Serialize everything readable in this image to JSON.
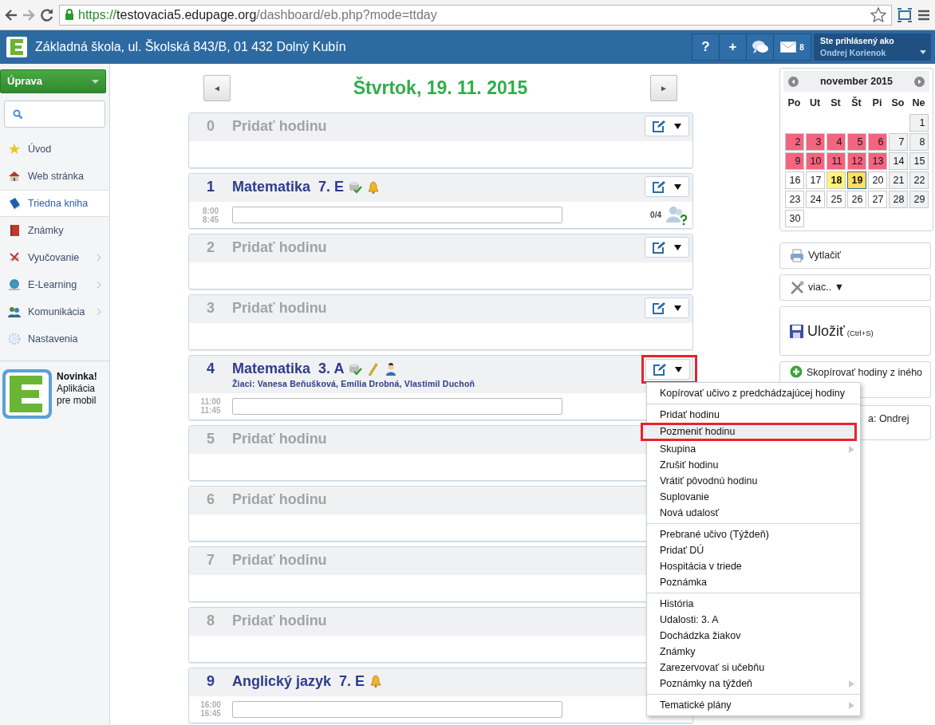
{
  "browser": {
    "url": {
      "scheme": "https://",
      "host": "testovacia5.edupage.org",
      "path": "/dashboard/eb.php?mode=ttday"
    }
  },
  "header": {
    "school": "Základná škola, ul. Školská 843/B, 01 432 Dolný Kubín",
    "buttons": [
      {
        "kind": "text",
        "label": "?"
      },
      {
        "kind": "text",
        "label": "+"
      },
      {
        "kind": "chat"
      },
      {
        "kind": "mail",
        "count": "8"
      }
    ],
    "user": {
      "caption": "Ste prihlásený ako",
      "name": "Ondrej Korienok"
    }
  },
  "sidebar": {
    "edit_button": "Úprava",
    "items": [
      {
        "label": "Úvod",
        "selected": false,
        "has_submenu": false
      },
      {
        "label": "Web stránka",
        "selected": false,
        "has_submenu": false
      },
      {
        "label": "Triedna kniha",
        "selected": true,
        "has_submenu": false
      },
      {
        "label": "Známky",
        "selected": false,
        "has_submenu": false
      },
      {
        "label": "Vyučovanie",
        "selected": false,
        "has_submenu": true
      },
      {
        "label": "E-Learning",
        "selected": false,
        "has_submenu": true
      },
      {
        "label": "Komunikácia",
        "selected": false,
        "has_submenu": true
      },
      {
        "label": "Nastavenia",
        "selected": false,
        "has_submenu": false
      }
    ],
    "promo": "**Novinka!** Aplikácia pre mobil"
  },
  "day": {
    "prev": "◄",
    "title": "Štvrtok, 19. 11. 2015",
    "next": "►"
  },
  "lessons": [
    {
      "number": "0",
      "kind": "empty",
      "title": "Pridať hodinu"
    },
    {
      "number": "1",
      "kind": "lesson",
      "subject": "Matematika",
      "class": "7. E",
      "badges": [
        {
          "kind": "check"
        },
        {
          "kind": "bell"
        }
      ],
      "start": "8:00",
      "end": "8:45",
      "attendance": "0/4"
    },
    {
      "number": "2",
      "kind": "empty",
      "title": "Pridať hodinu"
    },
    {
      "number": "3",
      "kind": "empty",
      "title": "Pridať hodinu"
    },
    {
      "number": "4",
      "kind": "lesson",
      "subject": "Matematika",
      "class": "3. A",
      "badges": [
        {
          "kind": "check"
        },
        {
          "kind": "pencil"
        },
        {
          "kind": "person"
        }
      ],
      "students": "Žiaci: Vanesa Beňušková, Emília Drobná, Vlastimil Duchoň",
      "start": "11:00",
      "end": "11:45",
      "highlighted": true,
      "menu_open": true
    },
    {
      "number": "5",
      "kind": "empty",
      "title": "Pridať hodinu"
    },
    {
      "number": "6",
      "kind": "empty",
      "title": "Pridať hodinu"
    },
    {
      "number": "7",
      "kind": "empty",
      "title": "Pridať hodinu"
    },
    {
      "number": "8",
      "kind": "empty",
      "title": "Pridať hodinu"
    },
    {
      "number": "9",
      "kind": "lesson",
      "subject": "Anglický jazyk",
      "class": "7. E",
      "badges": [
        {
          "kind": "bell"
        }
      ],
      "start": "16:00",
      "end": "16:45"
    }
  ],
  "menu": {
    "groups": [
      [
        {
          "label": "Kopírovať učivo z predchádzajúcej hodiny",
          "has_submenu": false,
          "highlighted": false
        }
      ],
      [
        {
          "label": "Pridať hodinu",
          "has_submenu": false,
          "highlighted": false
        },
        {
          "label": "Pozmeniť hodinu",
          "has_submenu": false,
          "highlighted": true
        },
        {
          "label": "Skupina",
          "has_submenu": true,
          "highlighted": false
        },
        {
          "label": "Zrušiť hodinu",
          "has_submenu": false,
          "highlighted": false
        },
        {
          "label": "Vrátiť pôvodnú hodinu",
          "has_submenu": false,
          "highlighted": false
        },
        {
          "label": "Suplovanie",
          "has_submenu": false,
          "highlighted": false
        },
        {
          "label": "Nová udalosť",
          "has_submenu": false,
          "highlighted": false
        }
      ],
      [
        {
          "label": "Prebrané učivo (Týždeň)",
          "has_submenu": false,
          "highlighted": false
        },
        {
          "label": "Pridať DÚ",
          "has_submenu": false,
          "highlighted": false
        },
        {
          "label": "Hospitácia v triede",
          "has_submenu": false,
          "highlighted": false
        },
        {
          "label": "Poznámka",
          "has_submenu": false,
          "highlighted": false
        }
      ],
      [
        {
          "label": "História",
          "has_submenu": false,
          "highlighted": false
        },
        {
          "label": "Udalosti: 3. A",
          "has_submenu": false,
          "highlighted": false
        },
        {
          "label": "Dochádzka žiakov",
          "has_submenu": false,
          "highlighted": false
        },
        {
          "label": "Známky",
          "has_submenu": false,
          "highlighted": false
        },
        {
          "label": "Zarezervovať si učebňu",
          "has_submenu": false,
          "highlighted": false
        },
        {
          "label": "Poznámky na týždeň",
          "has_submenu": true,
          "highlighted": false
        }
      ],
      [
        {
          "label": "Tematické plány",
          "has_submenu": true,
          "highlighted": false
        }
      ]
    ]
  },
  "calendar": {
    "month": "november 2015",
    "weekdays": [
      "Po",
      "Ut",
      "St",
      "Št",
      "Pi",
      "So",
      "Ne"
    ],
    "days": [
      {
        "kind": "blank"
      },
      {
        "kind": "blank"
      },
      {
        "kind": "blank"
      },
      {
        "kind": "blank"
      },
      {
        "kind": "blank"
      },
      {
        "kind": "blank"
      },
      {
        "day": "1",
        "kind": "weekend",
        "selected": false
      },
      {
        "day": "2",
        "kind": "marked",
        "selected": false
      },
      {
        "day": "3",
        "kind": "marked",
        "selected": false
      },
      {
        "day": "4",
        "kind": "marked",
        "selected": false
      },
      {
        "day": "5",
        "kind": "marked",
        "selected": false
      },
      {
        "day": "6",
        "kind": "marked",
        "selected": false
      },
      {
        "day": "7",
        "kind": "weekend",
        "selected": false
      },
      {
        "day": "8",
        "kind": "weekend",
        "selected": false
      },
      {
        "day": "9",
        "kind": "marked",
        "selected": false
      },
      {
        "day": "10",
        "kind": "marked",
        "selected": false
      },
      {
        "day": "11",
        "kind": "marked",
        "selected": false
      },
      {
        "day": "12",
        "kind": "marked",
        "selected": false
      },
      {
        "day": "13",
        "kind": "marked",
        "selected": false
      },
      {
        "day": "14",
        "kind": "weekend",
        "selected": false
      },
      {
        "day": "15",
        "kind": "weekend",
        "selected": false
      },
      {
        "day": "16",
        "kind": "plain",
        "selected": false
      },
      {
        "day": "17",
        "kind": "plain",
        "selected": false
      },
      {
        "day": "18",
        "kind": "event",
        "selected": false
      },
      {
        "day": "19",
        "kind": "event",
        "selected": true
      },
      {
        "day": "20",
        "kind": "plain",
        "selected": false
      },
      {
        "day": "21",
        "kind": "weekend",
        "selected": false
      },
      {
        "day": "22",
        "kind": "weekend",
        "selected": false
      },
      {
        "day": "23",
        "kind": "plain",
        "selected": false
      },
      {
        "day": "24",
        "kind": "plain",
        "selected": false
      },
      {
        "day": "25",
        "kind": "plain",
        "selected": false
      },
      {
        "day": "26",
        "kind": "plain",
        "selected": false
      },
      {
        "day": "27",
        "kind": "plain",
        "selected": false
      },
      {
        "day": "28",
        "kind": "weekend",
        "selected": false
      },
      {
        "day": "29",
        "kind": "weekend",
        "selected": false
      },
      {
        "day": "30",
        "kind": "plain",
        "selected": false
      }
    ]
  },
  "actions": [
    {
      "kind": "print",
      "label": "Vytlačiť"
    },
    {
      "kind": "more",
      "label": "viac.. ▼"
    },
    {
      "kind": "save",
      "label": "Uložiť",
      "shortcut": "(Ctrl+S)"
    },
    {
      "kind": "copy",
      "label": "Skopírovať hodiny z iného"
    },
    {
      "kind": "partial",
      "label": "a: Ondrej"
    }
  ]
}
